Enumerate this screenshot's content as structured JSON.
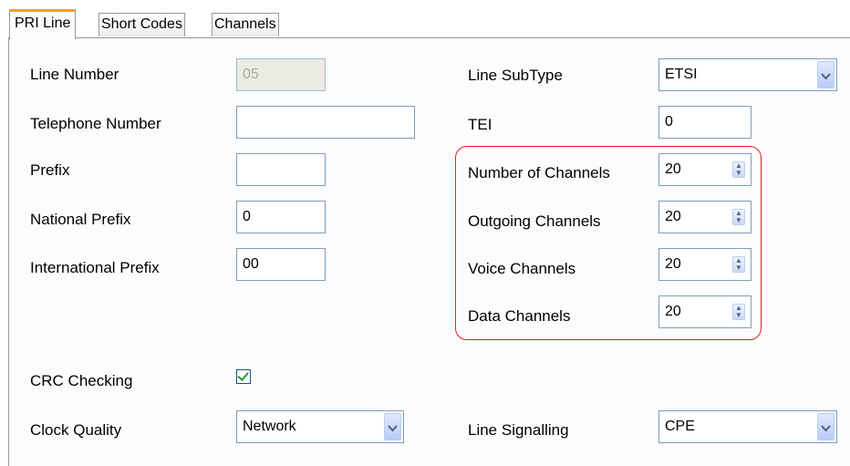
{
  "tabs": [
    {
      "label": "PRI Line",
      "active": true
    },
    {
      "label": "Short Codes",
      "active": false
    },
    {
      "label": "Channels",
      "active": false
    }
  ],
  "left": {
    "line_number": {
      "label": "Line Number",
      "value": "05",
      "disabled": true
    },
    "telephone_number": {
      "label": "Telephone Number",
      "value": ""
    },
    "prefix": {
      "label": "Prefix",
      "value": ""
    },
    "national_prefix": {
      "label": "National Prefix",
      "value": "0"
    },
    "international_prefix": {
      "label": "International Prefix",
      "value": "00"
    },
    "crc_checking": {
      "label": "CRC Checking",
      "checked": true
    },
    "clock_quality": {
      "label": "Clock Quality",
      "value": "Network"
    }
  },
  "right": {
    "line_subtype": {
      "label": "Line SubType",
      "value": "ETSI"
    },
    "tei": {
      "label": "TEI",
      "value": "0"
    },
    "number_of_channels": {
      "label": "Number of Channels",
      "value": "20"
    },
    "outgoing_channels": {
      "label": "Outgoing Channels",
      "value": "20"
    },
    "voice_channels": {
      "label": "Voice Channels",
      "value": "20"
    },
    "data_channels": {
      "label": "Data Channels",
      "value": "20"
    },
    "line_signalling": {
      "label": "Line Signalling",
      "value": "CPE"
    }
  },
  "icons": {
    "dropdown": "chevron-down-icon",
    "spinner": "up-down-spinner-icon",
    "check": "checkmark-icon"
  },
  "colors": {
    "highlight": "#e02020",
    "active_tab_accent": "#f0a030"
  }
}
